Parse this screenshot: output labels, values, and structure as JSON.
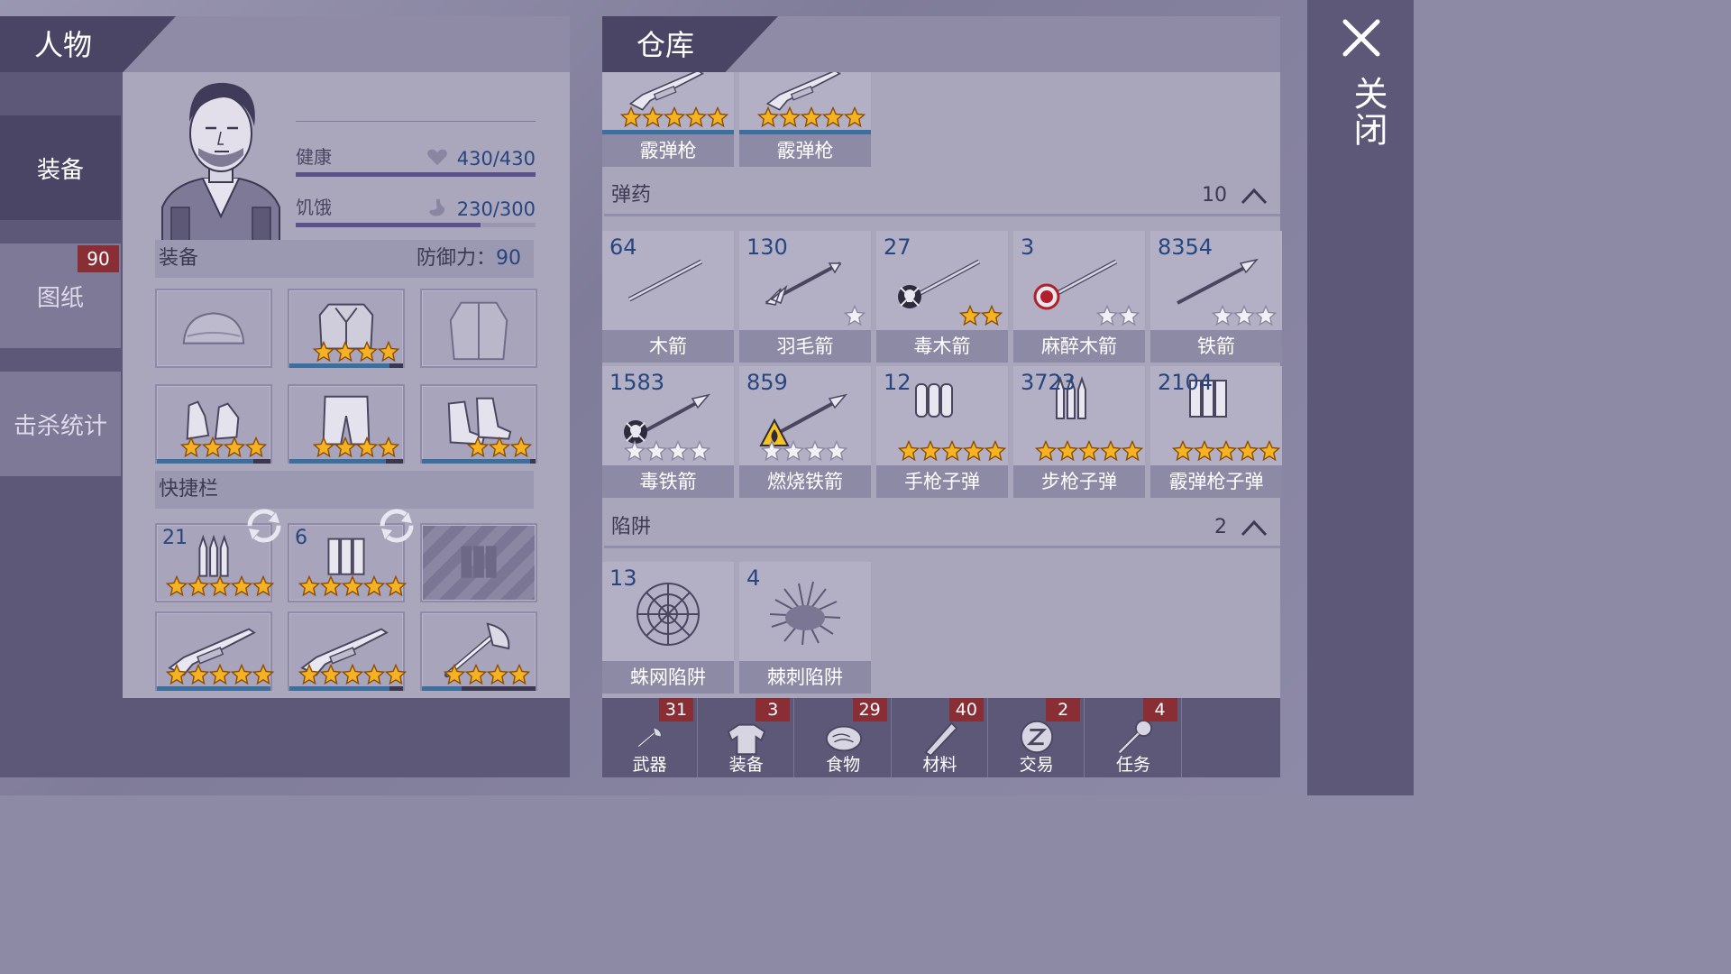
{
  "character": {
    "title": "人物",
    "tabs": [
      {
        "label": "装备",
        "badge": ""
      },
      {
        "label": "图纸",
        "badge": "90"
      },
      {
        "label": "击杀统计",
        "badge": ""
      }
    ],
    "stats": {
      "health_label": "健康",
      "health_value": "430/430",
      "health_fraction": 1.0,
      "hunger_label": "饥饿",
      "hunger_value": "230/300",
      "hunger_fraction": 0.77
    },
    "equipment": {
      "label": "装备",
      "defense_label": "防御力：",
      "defense_value": "90",
      "slots": [
        {
          "icon": "helmet-icon",
          "stars": 0,
          "durability": 0
        },
        {
          "icon": "armor-icon",
          "stars": 4,
          "durability": 0.88
        },
        {
          "icon": "jacket-icon",
          "stars": 0,
          "durability": 0
        },
        {
          "icon": "gloves-icon",
          "stars": 4,
          "durability": 0.85
        },
        {
          "icon": "pants-icon",
          "stars": 4,
          "durability": 0.85
        },
        {
          "icon": "boots-icon",
          "stars": 3,
          "durability": 0.95
        }
      ]
    },
    "hotbar": {
      "label": "快捷栏",
      "ammo": [
        {
          "count": "21",
          "icon": "rifle-ammo-icon",
          "stars": 5
        },
        {
          "count": "6",
          "icon": "shotgun-ammo-icon",
          "stars": 5
        },
        {
          "count": "",
          "icon": "locked-ammo-icon",
          "stars": 0
        }
      ],
      "weapons": [
        {
          "icon": "shotgun-icon",
          "stars": 5,
          "durability": 1.0
        },
        {
          "icon": "shotgun-icon",
          "stars": 5,
          "durability": 0.88
        },
        {
          "icon": "axe-icon",
          "stars": 4,
          "durability": 0.35
        }
      ]
    }
  },
  "storage": {
    "title": "仓库",
    "top_items": [
      {
        "name": "霰弹枪",
        "icon": "shotgun-icon",
        "stars": 5
      },
      {
        "name": "霰弹枪",
        "icon": "shotgun-icon",
        "stars": 5
      }
    ],
    "ammo_group": {
      "label": "弹药",
      "count": "10"
    },
    "ammo": [
      {
        "count": "64",
        "name": "木箭",
        "icon": "wooden-arrow-icon",
        "stars": 0,
        "badge": ""
      },
      {
        "count": "130",
        "name": "羽毛箭",
        "icon": "feather-arrow-icon",
        "stars": 1,
        "star_color": "white",
        "badge": ""
      },
      {
        "count": "27",
        "name": "毒木箭",
        "icon": "poison-arrow-icon",
        "stars": 2,
        "star_color": "gold",
        "badge": "skull"
      },
      {
        "count": "3",
        "name": "麻醉木箭",
        "icon": "tranq-arrow-icon",
        "stars": 2,
        "star_color": "white",
        "badge": "tranq"
      },
      {
        "count": "8354",
        "name": "铁箭",
        "icon": "iron-arrow-icon",
        "stars": 3,
        "star_color": "white",
        "badge": ""
      },
      {
        "count": "1583",
        "name": "毒铁箭",
        "icon": "poison-iron-arrow-icon",
        "stars": 4,
        "star_color": "white",
        "badge": "skull"
      },
      {
        "count": "859",
        "name": "燃烧铁箭",
        "icon": "fire-arrow-icon",
        "stars": 4,
        "star_color": "white",
        "badge": "fire"
      },
      {
        "count": "12",
        "name": "手枪子弹",
        "icon": "pistol-ammo-icon",
        "stars": 5,
        "star_color": "gold",
        "badge": ""
      },
      {
        "count": "3723",
        "name": "步枪子弹",
        "icon": "rifle-ammo-icon",
        "stars": 5,
        "star_color": "gold",
        "badge": ""
      },
      {
        "count": "2104",
        "name": "霰弹枪子弹",
        "icon": "shotgun-ammo-icon",
        "stars": 5,
        "star_color": "gold",
        "badge": ""
      }
    ],
    "trap_group": {
      "label": "陷阱",
      "count": "2"
    },
    "traps": [
      {
        "count": "13",
        "name": "蛛网陷阱",
        "icon": "web-trap-icon"
      },
      {
        "count": "4",
        "name": "棘刺陷阱",
        "icon": "spike-trap-icon"
      }
    ],
    "categories": [
      {
        "label": "武器",
        "badge": "31",
        "icon": "axe-icon"
      },
      {
        "label": "装备",
        "badge": "3",
        "icon": "shirt-icon"
      },
      {
        "label": "食物",
        "badge": "29",
        "icon": "meat-icon"
      },
      {
        "label": "材料",
        "badge": "40",
        "icon": "log-icon"
      },
      {
        "label": "交易",
        "badge": "2",
        "icon": "coin-icon"
      },
      {
        "label": "任务",
        "badge": "4",
        "icon": "key-icon"
      }
    ]
  },
  "close": {
    "label": "关闭"
  },
  "colors": {
    "badge": "#8a2e35",
    "count": "#27457e",
    "panel_dark": "#5e5878",
    "durability": "#3b6fa0"
  }
}
